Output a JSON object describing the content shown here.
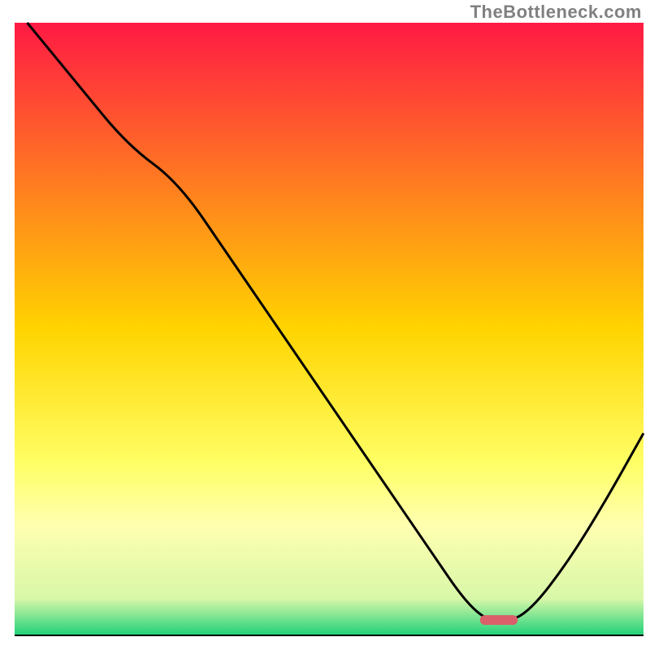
{
  "watermark": "TheBottleneck.com",
  "chart_data": {
    "type": "line",
    "title": "",
    "xlabel": "",
    "ylabel": "",
    "xlim": [
      0,
      100
    ],
    "ylim": [
      0,
      100
    ],
    "grid": false,
    "legend": false,
    "annotations": [
      {
        "name": "marker",
        "x_start": 74,
        "x_end": 80,
        "y": 2.5,
        "color": "#d9606a"
      }
    ],
    "background_gradient": {
      "stops": [
        {
          "offset": 0,
          "color": "#ff1a44"
        },
        {
          "offset": 50,
          "color": "#ffd400"
        },
        {
          "offset": 72,
          "color": "#ffff66"
        },
        {
          "offset": 82,
          "color": "#ffffb0"
        },
        {
          "offset": 94,
          "color": "#d8f7a8"
        },
        {
          "offset": 100,
          "color": "#1fd17a"
        }
      ]
    },
    "series": [
      {
        "name": "bottleneck-curve",
        "color": "#000000",
        "x": [
          2,
          10,
          18,
          26,
          34,
          42,
          50,
          58,
          66,
          72,
          76,
          78,
          82,
          88,
          94,
          100
        ],
        "y": [
          100,
          90,
          80,
          74,
          62,
          50,
          38,
          26,
          14,
          5,
          2,
          2,
          4,
          12,
          22,
          33
        ]
      }
    ]
  }
}
